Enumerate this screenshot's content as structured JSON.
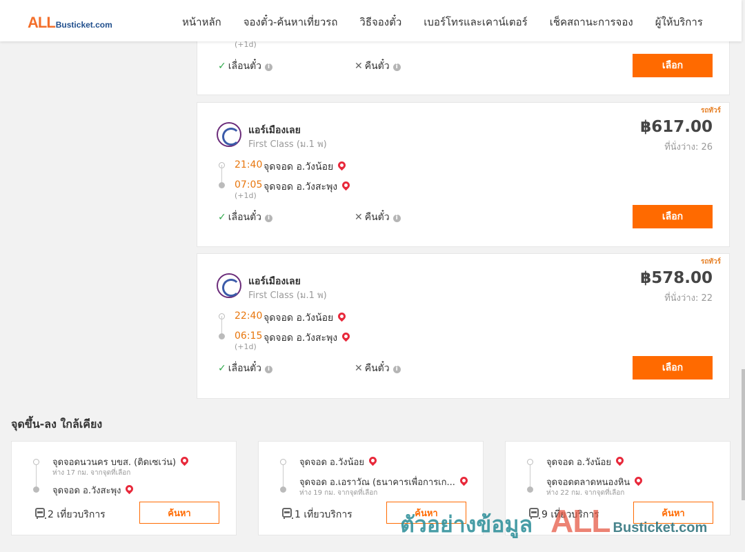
{
  "header": {
    "logo_all": "ALL",
    "logo_busticket": "Busticket.com",
    "nav": [
      "หน้าหลัก",
      "จองตั๋ว-ค้นหาเที่ยวรถ",
      "วิธีจองตั๋ว",
      "เบอร์โทรและเคาน์เตอร์",
      "เช็คสถานะการจอง",
      "ผู้ให้บริการ"
    ]
  },
  "trips": [
    {
      "next_day": "(+1d)",
      "reschedule": "เลื่อนตั๋ว",
      "refund": "คืนตั๋ว",
      "select_label": "เลือก"
    },
    {
      "tag": "รถทัวร์",
      "operator": "แอร์เมืองเลย",
      "bus_class": "First Class (ม.1 พ)",
      "price": "฿617.00",
      "seats": "ที่นั่งว่าง: 26",
      "dep_time": "21:40",
      "dep_stop": "จุดจอด อ.วังน้อย",
      "arr_time": "07:05",
      "arr_stop": "จุดจอด อ.วังสะพุง",
      "next_day": "(+1d)",
      "reschedule": "เลื่อนตั๋ว",
      "refund": "คืนตั๋ว",
      "select_label": "เลือก"
    },
    {
      "tag": "รถทัวร์",
      "operator": "แอร์เมืองเลย",
      "bus_class": "First Class (ม.1 พ)",
      "price": "฿578.00",
      "seats": "ที่นั่งว่าง: 22",
      "dep_time": "22:40",
      "dep_stop": "จุดจอด อ.วังน้อย",
      "arr_time": "06:15",
      "arr_stop": "จุดจอด อ.วังสะพุง",
      "next_day": "(+1d)",
      "reschedule": "เลื่อนตั๋ว",
      "refund": "คืนตั๋ว",
      "select_label": "เลือก"
    }
  ],
  "nearby": {
    "title": "จุดขึ้น-ลง ใกล้เคียง",
    "items": [
      {
        "from": "จุดจอดนวนคร บขส. (ติดเซเว่น)",
        "from_distance": "ห่าง 17 กม. จากจุดที่เลือก",
        "to": "จุดจอด อ.วังสะพุง",
        "to_distance": "",
        "trips": "2 เที่ยวบริการ",
        "search_label": "ค้นหา"
      },
      {
        "from": "จุดจอด อ.วังน้อย",
        "from_distance": "",
        "to": "จุดจอด อ.เอราวัณ (ธนาคารเพื่อการเก...",
        "to_distance": "ห่าง 19 กม. จากจุดที่เลือก",
        "trips": "1 เที่ยวบริการ",
        "search_label": "ค้นหา"
      },
      {
        "from": "จุดจอด อ.วังน้อย",
        "from_distance": "",
        "to": "จุดจอดตลาดหนองหิน",
        "to_distance": "ห่าง 22 กม. จากจุดที่เลือก",
        "trips": "9 เที่ยวบริการ",
        "search_label": "ค้นหา"
      }
    ]
  },
  "watermark": {
    "thai": "ตัวอย่างข้อมูล",
    "all": "ALL",
    "busticket": "Busticket.com"
  },
  "colors": {
    "accent": "#ff6a00",
    "time": "#e8760d",
    "check": "#2ea84a",
    "pin": "#e8293b"
  }
}
